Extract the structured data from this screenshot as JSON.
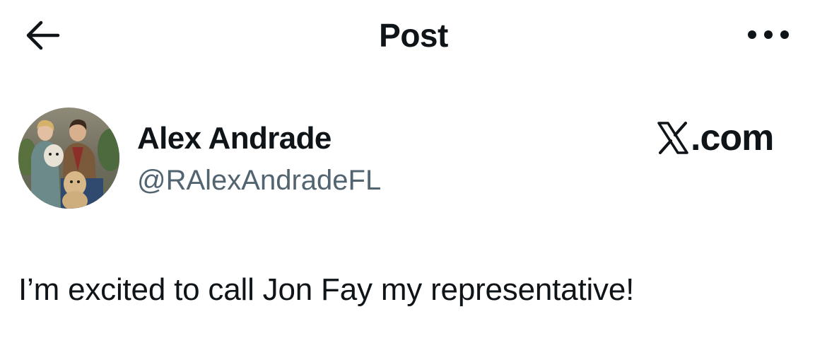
{
  "header": {
    "title": "Post",
    "back_icon": "arrow-left-icon",
    "more_icon": "more-horizontal-icon"
  },
  "post": {
    "author": {
      "display_name": "Alex Andrade",
      "handle": "@RAlexAndradeFL",
      "avatar": "profile-photo"
    },
    "brand": {
      "text": ".com",
      "logo_icon": "x-logo-icon"
    },
    "text": "I’m excited to call Jon Fay my representative!"
  },
  "colors": {
    "text_primary": "#0f1419",
    "text_secondary": "#536471",
    "background": "#ffffff"
  }
}
